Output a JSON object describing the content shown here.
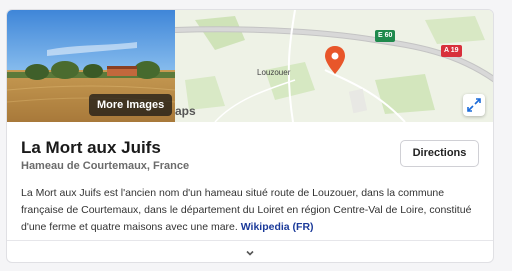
{
  "media": {
    "more_images_label": "More Images",
    "maps_attribution": "aps",
    "map_place_label": "Louzouer",
    "road_shields": [
      "E 60",
      "A 19"
    ]
  },
  "place": {
    "title": "La Mort aux Juifs",
    "subtitle": "Hameau de Courtemaux, France",
    "directions_label": "Directions",
    "description": "La Mort aux Juifs est l'ancien nom d'un hameau situé route de Louzouer, dans la commune française de Courtemaux, dans le département du Loiret en région Centre-Val de Loire, constitué d'une ferme et quatre maisons avec une mare.",
    "wiki_link": "Wikipedia (FR)"
  },
  "icons": {
    "map_pin": "map-pin-icon",
    "expand": "expand-icon",
    "expand_footer": "chevron-down-icon"
  },
  "colors": {
    "pin": "#e8562a",
    "link": "#1b3a9a",
    "e60": "#1f8a4c",
    "a19": "#d8303b"
  }
}
